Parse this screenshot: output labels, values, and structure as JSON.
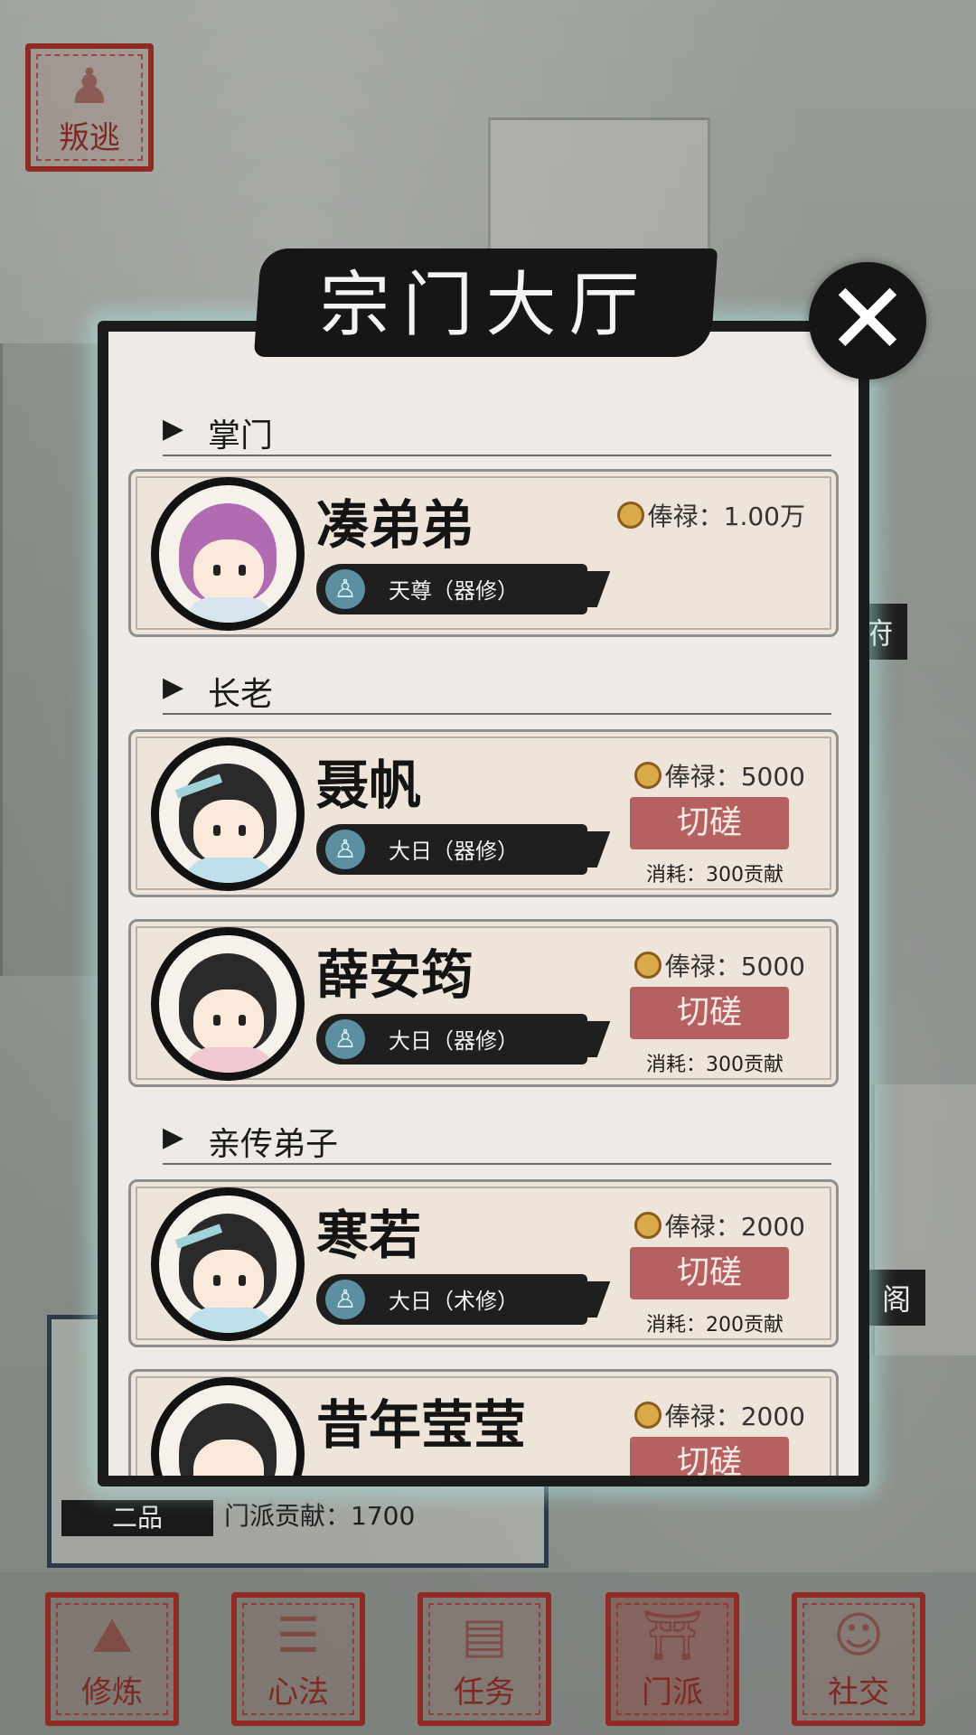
{
  "top_left_button": {
    "label": "叛逃",
    "icon": "figure-icon"
  },
  "dialog": {
    "title": "宗门大厅",
    "close_icon": "close-x-icon",
    "salary_label": "俸禄：",
    "spar_label": "切磋",
    "sections": [
      {
        "label": "掌门"
      },
      {
        "label": "长老"
      },
      {
        "label": "亲传弟子"
      }
    ],
    "members": [
      {
        "name": "凑弟弟",
        "realm": "天尊（器修）",
        "salary": "1.00万",
        "spar": false,
        "cost": "",
        "hair": "#b06ab0"
      },
      {
        "name": "聂帆",
        "realm": "大日（器修）",
        "salary": "5000",
        "spar": true,
        "cost": "消耗：300贡献",
        "hair": "#2a2a2a"
      },
      {
        "name": "薛安筠",
        "realm": "大日（器修）",
        "salary": "5000",
        "spar": true,
        "cost": "消耗：300贡献",
        "hair": "#2a2a2a"
      },
      {
        "name": "寒若",
        "realm": "大日（术修）",
        "salary": "2000",
        "spar": true,
        "cost": "消耗：200贡献",
        "hair": "#2a2a2a"
      },
      {
        "name": "昔年莹莹",
        "realm": "",
        "salary": "2000",
        "spar": true,
        "cost": "",
        "hair": "#2a2a2a"
      }
    ]
  },
  "side_labels": [
    "府",
    "阁"
  ],
  "player_card": {
    "rank": "二品",
    "contribution": "门派贡献：1700"
  },
  "nav": [
    {
      "label": "修炼",
      "active": false
    },
    {
      "label": "心法",
      "active": false
    },
    {
      "label": "任务",
      "active": false
    },
    {
      "label": "门派",
      "active": true
    },
    {
      "label": "社交",
      "active": false
    }
  ],
  "colors": {
    "seal_red": "#8e2b25",
    "spar_button": "#b5615f",
    "dialog_glow": "#aae6e1",
    "card_bg": "#efe4da"
  }
}
